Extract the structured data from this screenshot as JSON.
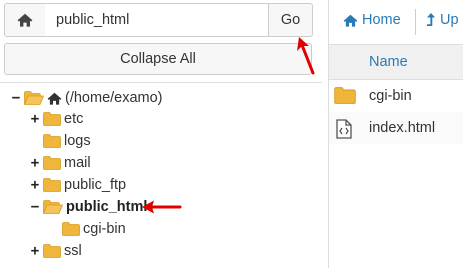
{
  "path_bar": {
    "home_icon": "home-icon",
    "path_value": "public_html",
    "go_label": "Go"
  },
  "collapse_label": "Collapse All",
  "tree": {
    "root": {
      "label": "(/home/examo)",
      "toggle": "−"
    },
    "items": [
      {
        "label": "etc",
        "toggle": "+"
      },
      {
        "label": "logs",
        "toggle": ""
      },
      {
        "label": "mail",
        "toggle": "+"
      },
      {
        "label": "public_ftp",
        "toggle": "+"
      },
      {
        "label": "public_html",
        "toggle": "−",
        "selected": true
      },
      {
        "label": "cgi-bin",
        "toggle": ""
      },
      {
        "label": "ssl",
        "toggle": "+"
      }
    ]
  },
  "toolbar": {
    "home_label": "Home",
    "up_label": "Up"
  },
  "file_list": {
    "header_name": "Name",
    "files": [
      {
        "name": "cgi-bin",
        "icon": "folder-icon"
      },
      {
        "name": "index.html",
        "icon": "code-file-icon"
      }
    ]
  },
  "colors": {
    "folder": "#e8a72c",
    "link": "#2a7ab5",
    "arrow": "#e00000"
  }
}
